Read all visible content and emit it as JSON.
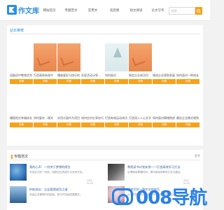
{
  "header": {
    "logo_text": "作文库",
    "nav": [
      "网站首页",
      "专题范文",
      "实用文",
      "读后感",
      "短文阅读",
      "论文写作"
    ],
    "search_placeholder": "搜索"
  },
  "featured": {
    "title": "站长推荐",
    "button_label": "详情",
    "row1": [
      {
        "caption": "班级初中教育优秀",
        "thumb": "blank"
      },
      {
        "caption": "打造高效有效中",
        "thumb": "orange"
      },
      {
        "caption": "播放爱好与快乐的",
        "thumb": "orange"
      },
      {
        "caption": "实现活动计划…",
        "thumb": "blank"
      },
      {
        "caption": "如何面对…",
        "thumb": "winter"
      },
      {
        "caption": "制定企业成功目",
        "thumb": "orange"
      },
      {
        "caption": "增进企业规划发展",
        "thumb": "blank"
      },
      {
        "caption": "如何面对一种成长",
        "thumb": "blank"
      }
    ],
    "row2": [
      {
        "caption": "播报阳光幸福成长"
      },
      {
        "caption": "如何复杂…模式"
      },
      {
        "caption": "实用方面作为项目"
      },
      {
        "caption": "如何应对分享技巧"
      },
      {
        "caption": "打造有效运动成功"
      },
      {
        "caption": "打造深入人心文字"
      },
      {
        "caption": "如何面对情绪焦虑"
      },
      {
        "caption": "最佳企业模式规划"
      }
    ]
  },
  "articles": {
    "title": "专题范文",
    "more": "更多",
    "items": [
      {
        "title": "我的心声：一份关于梦想的感言",
        "desc": "写给自己的一封信，回顾过往的成长与未来方向。",
        "date": "2024-02-05"
      },
      {
        "title": "寒假读书计划安排——打造高效学习方法",
        "desc": "合理规划寒假时间，提升阅读效率的方法与建议。",
        "date": "2024-02-05"
      },
      {
        "title": "护航成长：企业管理成功之道",
        "desc": "总结企业管理中的经验，探讨可持续发展模式。",
        "date": ""
      },
      {
        "title": "如何写好一篇作文的技巧",
        "desc": "从立意到结构，全面提升写作能力的建议。",
        "date": ""
      }
    ]
  },
  "watermark": {
    "text": "008导航"
  },
  "colors": {
    "accent": "#f7a21b",
    "brand": "#2b8fe0"
  }
}
